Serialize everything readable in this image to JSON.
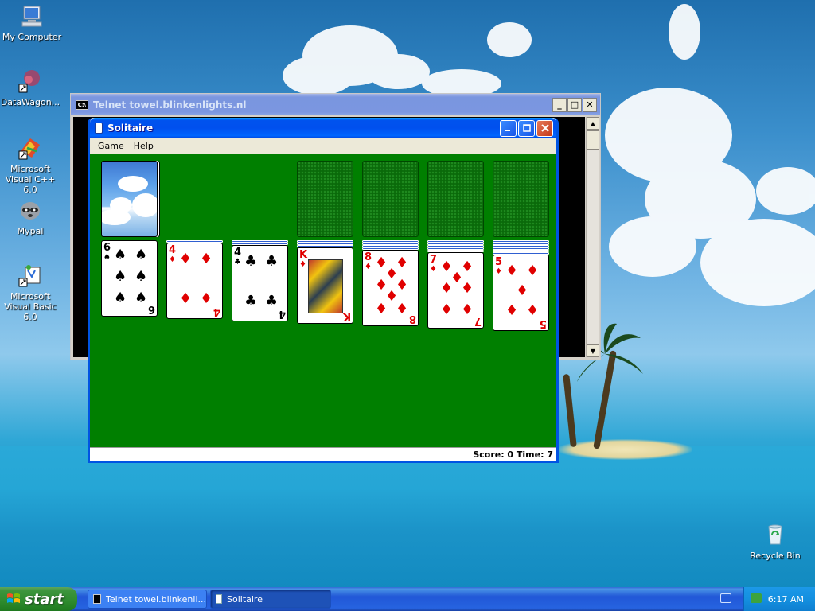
{
  "desktop": {
    "icons": [
      {
        "label": "My Computer"
      },
      {
        "label": "DataWagon..."
      },
      {
        "label": "Microsoft Visual C++ 6.0"
      },
      {
        "label": "Mypal"
      },
      {
        "label": "Microsoft Visual Basic 6.0"
      },
      {
        "label": "Recycle Bin"
      }
    ]
  },
  "telnet": {
    "title": "Telnet towel.blinkenlights.nl",
    "buttons": {
      "minimize": "_",
      "maximize": "□",
      "close": "✕"
    }
  },
  "solitaire": {
    "title": "Solitaire",
    "menu": [
      "Game",
      "Help"
    ],
    "status": "Score: 0 Time: 7",
    "tableau": [
      {
        "rank": "6",
        "suit": "♠",
        "color": "black",
        "hidden": 0
      },
      {
        "rank": "4",
        "suit": "♦",
        "color": "red",
        "hidden": 1
      },
      {
        "rank": "4",
        "suit": "♣",
        "color": "black",
        "hidden": 2
      },
      {
        "rank": "K",
        "suit": "♦",
        "color": "red",
        "hidden": 3
      },
      {
        "rank": "8",
        "suit": "♦",
        "color": "red",
        "hidden": 4
      },
      {
        "rank": "7",
        "suit": "♦",
        "color": "red",
        "hidden": 5
      },
      {
        "rank": "5",
        "suit": "♦",
        "color": "red",
        "hidden": 6
      }
    ]
  },
  "taskbar": {
    "start_label": "start",
    "tasks": [
      {
        "label": "Telnet towel.blinkenli...",
        "active": false
      },
      {
        "label": "Solitaire",
        "active": true
      }
    ],
    "clock": "6:17 AM"
  },
  "colors": {
    "felt": "#007f00",
    "xp_blue": "#0054e3",
    "start_green": "#2e8b2e",
    "red_suit": "#e00000"
  }
}
